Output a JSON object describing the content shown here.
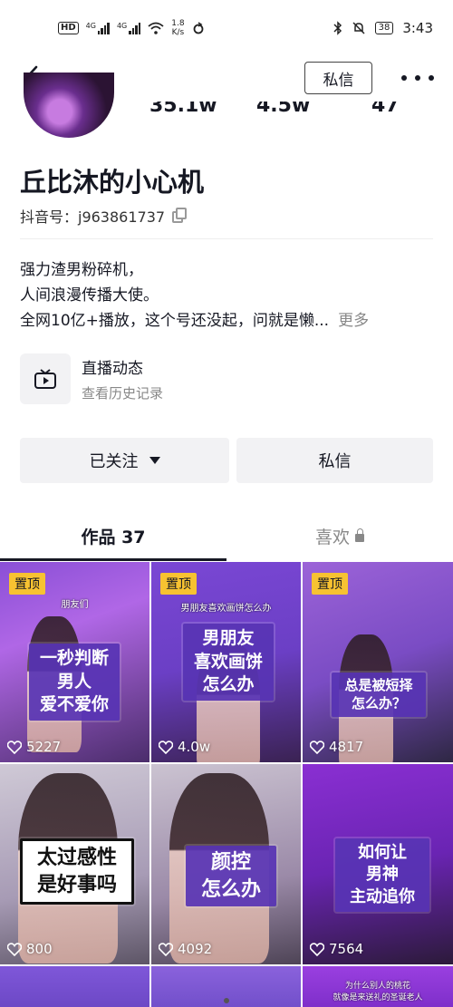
{
  "status_bar": {
    "hd": "HD",
    "sim1": "4G",
    "sim2": "4G",
    "speed": "1.8",
    "speed_unit": "K/s",
    "battery": "38",
    "time": "3:43"
  },
  "nav": {
    "back_icon": "chevron-left-icon",
    "message_label": "私信",
    "more_icon": "more-dots-icon"
  },
  "stats_fragments": [
    "35.1w",
    "4.5w",
    "47"
  ],
  "profile": {
    "name": "丘比沐的小心机",
    "id_label": "抖音号：j963861737",
    "bio_lines": [
      "强力渣男粉碎机，",
      "人间浪漫传播大使。",
      "全网10亿+播放，这个号还没起，问就是懒..."
    ],
    "bio_more": "更多"
  },
  "live": {
    "title": "直播动态",
    "subtitle": "查看历史记录"
  },
  "actions": {
    "follow_label": "已关注",
    "message_label": "私信"
  },
  "tabs": {
    "works": "作品 37",
    "likes": "喜欢"
  },
  "videos": [
    {
      "pinned": "置顶",
      "caption": "朋友们",
      "card": "一秒判断\n男人\n爱不爱你",
      "likes": "5227"
    },
    {
      "pinned": "置顶",
      "caption": "男朋友喜欢画饼怎么办",
      "card": "男朋友\n喜欢画饼\n怎么办",
      "likes": "4.0w"
    },
    {
      "pinned": "置顶",
      "caption": "",
      "card": "总是被短择\n怎么办？",
      "likes": "4817"
    },
    {
      "pinned": "",
      "caption": "",
      "card": "太过感性\n是好事吗",
      "likes": "800"
    },
    {
      "pinned": "",
      "caption": "",
      "card": "颜控\n怎么办",
      "likes": "4092"
    },
    {
      "pinned": "",
      "caption": "",
      "card": "如何让\n男神\n主动追你",
      "likes": "7564"
    },
    {
      "pinned": "",
      "caption": "",
      "card": "",
      "likes": ""
    },
    {
      "pinned": "",
      "caption": "",
      "card": "",
      "likes": ""
    },
    {
      "pinned": "",
      "caption": "为什么别人的桃花\n就像是来送礼的圣诞老人",
      "card": "",
      "likes": ""
    }
  ],
  "colors": {
    "pinned_badge": "#f7c231",
    "card_purple": "#5834b4",
    "text_primary": "#161823",
    "text_secondary": "#888888"
  }
}
